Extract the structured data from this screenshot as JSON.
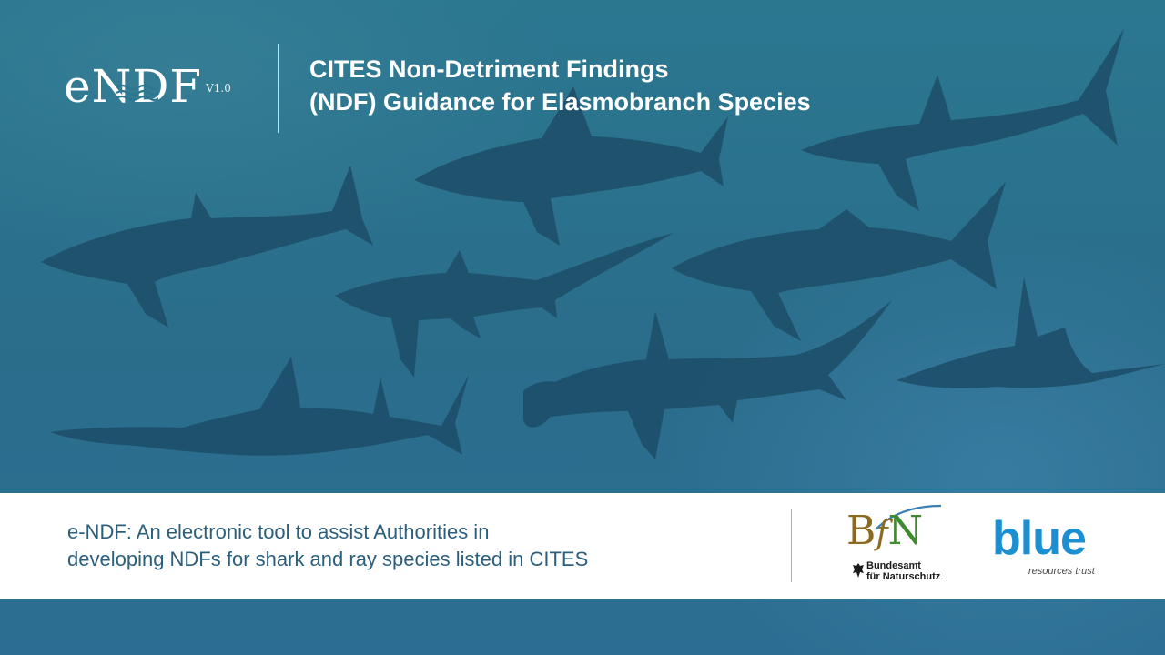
{
  "logo": {
    "name": "eNDF",
    "version": "V1.0"
  },
  "header": {
    "title_line1": "CITES Non-Detriment Findings",
    "title_line2": "(NDF) Guidance for Elasmobranch Species"
  },
  "banner": {
    "description_line1": "e-NDF: An electronic tool to assist Authorities in",
    "description_line2": "developing NDFs for shark and ray species listed in CITES"
  },
  "partners": {
    "bfn": {
      "letters_b": "B",
      "letters_f": "f",
      "letters_n": "N",
      "line1": "Bundesamt",
      "line2": "für Naturschutz"
    },
    "blue": {
      "word": "blue",
      "tagline": "resources trust"
    }
  },
  "colors": {
    "background": "#2b7790",
    "silhouette": "#1d4f6a",
    "banner": "#ffffff",
    "banner_text": "#2c5f7c",
    "blue_brand": "#1b8fd0",
    "bfn_gold": "#8b6a1f",
    "bfn_green": "#3f8a2e"
  }
}
